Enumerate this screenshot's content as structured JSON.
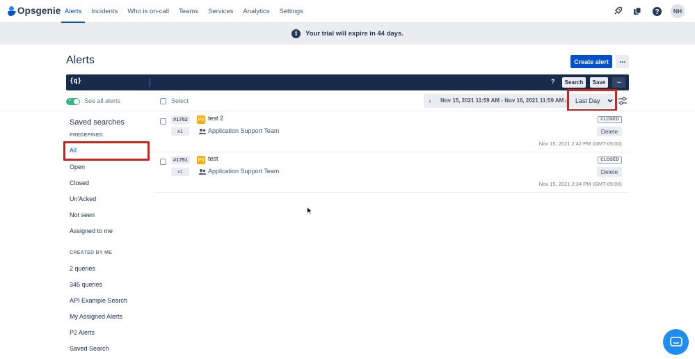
{
  "app": {
    "name": "Opsgenie"
  },
  "nav": {
    "links": [
      "Alerts",
      "Incidents",
      "Who is on-call",
      "Teams",
      "Services",
      "Analytics",
      "Settings"
    ],
    "active": "Alerts",
    "user_initials": "NH"
  },
  "banner": {
    "text": "Your trial will expire in 44 days."
  },
  "page": {
    "title": "Alerts",
    "create_button": "Create alert",
    "more_button": "···"
  },
  "searchbar": {
    "icon_text": "{q}",
    "help": "?",
    "search_button": "Search",
    "save_button": "Save",
    "more_button": "···"
  },
  "toolbar": {
    "see_all_label": "See all alerts",
    "select_label": "Select",
    "date_prev": "‹",
    "date_range": "Nov 15, 2021 11:59 AM - Nov 16, 2021 11:59 AM",
    "date_next": "›",
    "period": "Last Day"
  },
  "sidebar": {
    "title": "Saved searches",
    "predefined_label": "PREDEFINED",
    "predefined": [
      "All",
      "Open",
      "Closed",
      "Un'Acked",
      "Not seen",
      "Assigned to me"
    ],
    "created_label": "CREATED BY ME",
    "created": [
      "2 queries",
      "345 queries",
      "API Example Search",
      "My Assigned Alerts",
      "P2 Alerts",
      "Saved Search"
    ]
  },
  "alerts": [
    {
      "id": "#1752",
      "count": "x1",
      "priority": "P3",
      "message": "test 2",
      "team": "Application Support Team",
      "status": "CLOSED",
      "delete": "Delete",
      "time": "Nov 15, 2021 2:42 PM (GMT-05:00)"
    },
    {
      "id": "#1751",
      "count": "x1",
      "priority": "P3",
      "message": "test",
      "team": "Application Support Team",
      "status": "CLOSED",
      "delete": "Delete",
      "time": "Nov 15, 2021 2:34 PM (GMT-05:00)"
    }
  ],
  "colors": {
    "brand": "#0052CC",
    "searchbar": "#172B4D",
    "highlight": "#D0231B",
    "toggle_on": "#36B37E",
    "priority_p3": "#FFAB00",
    "chat": "#1F8DED"
  },
  "icons": [
    "rocket-icon",
    "app-switcher-icon",
    "help-icon",
    "info-icon",
    "filter-settings-icon",
    "team-icon",
    "chat-icon"
  ]
}
